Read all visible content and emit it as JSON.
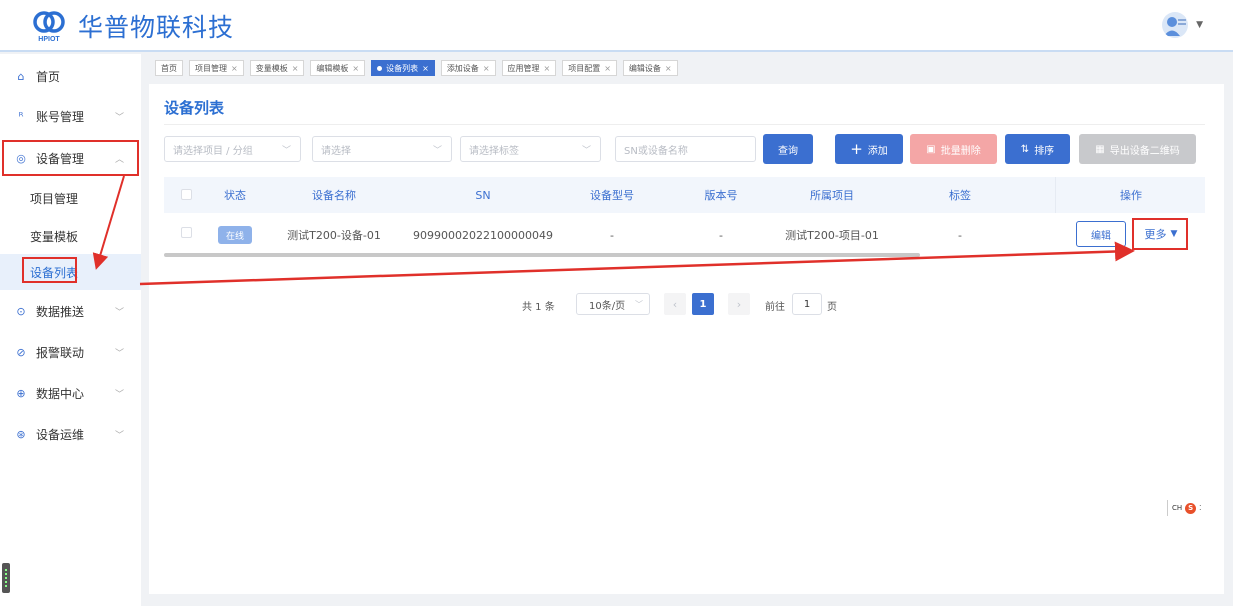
{
  "brand": {
    "name": "华普物联科技",
    "mark_text": "HPIOT"
  },
  "sidebar": {
    "items": [
      {
        "label": "首页",
        "icon": "home-icon"
      },
      {
        "label": "账号管理",
        "icon": "user-icon"
      },
      {
        "label": "设备管理",
        "icon": "device-icon"
      },
      {
        "label": "数据推送",
        "icon": "push-icon"
      },
      {
        "label": "报警联动",
        "icon": "alarm-icon"
      },
      {
        "label": "数据中心",
        "icon": "data-center-icon"
      },
      {
        "label": "设备运维",
        "icon": "maintenance-icon"
      }
    ],
    "sub_items": [
      "项目管理",
      "变量模板",
      "设备列表"
    ]
  },
  "tabs": [
    "首页",
    "项目管理",
    "变量模板",
    "编辑模板",
    "设备列表",
    "添加设备",
    "应用管理",
    "项目配置",
    "编辑设备"
  ],
  "main": {
    "title": "设备列表"
  },
  "filters": {
    "project_placeholder": "请选择项目 / 分组",
    "select_placeholder": "请选择",
    "tag_placeholder": "请选择标签",
    "sn_placeholder": "SN或设备名称"
  },
  "actions": {
    "query": "查询",
    "add": "添加",
    "batch_delete": "批量删除",
    "sort": "排序",
    "export_qr": "导出设备二维码"
  },
  "table": {
    "headers": [
      "状态",
      "设备名称",
      "SN",
      "设备型号",
      "版本号",
      "所属项目",
      "标签",
      "操作"
    ],
    "rows": [
      {
        "status": "在线",
        "name": "测试T200-设备-01",
        "sn": "90990002022100000049",
        "model": "-",
        "version": "-",
        "project": "测试T200-项目-01",
        "tag": "-",
        "edit": "编辑",
        "more": "更多"
      }
    ]
  },
  "pagination": {
    "total": "共 1 条",
    "page_size": "10条/页",
    "current_page": "1",
    "goto_label": "前往",
    "goto_value": "1",
    "page_unit": "页"
  },
  "ime": {
    "label": "CH",
    "icon_text": "S"
  },
  "colors": {
    "primary": "#3b6fd0",
    "danger_soft": "#f4a6a6",
    "annotation": "#e0302a"
  }
}
